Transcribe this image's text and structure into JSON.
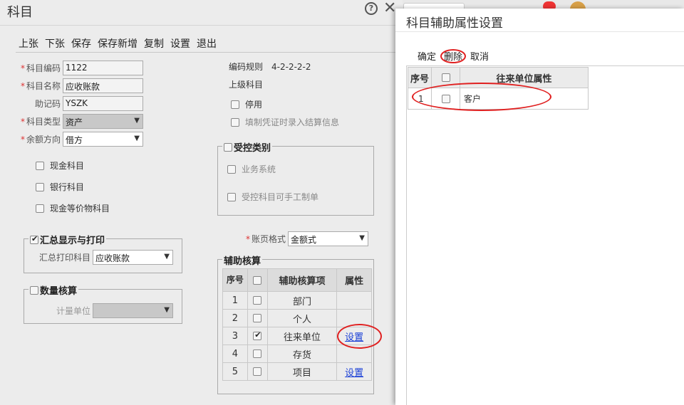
{
  "dialog": {
    "title": "科目",
    "help_glyph": "?",
    "close_glyph": "✕",
    "toolbar": [
      "上张",
      "下张",
      "保存",
      "保存新增",
      "复制",
      "设置",
      "退出"
    ]
  },
  "form": {
    "code": {
      "label": "科目编码",
      "value": "1122"
    },
    "name": {
      "label": "科目名称",
      "value": "应收账款"
    },
    "mnemonic": {
      "label": "助记码",
      "value": "YSZK"
    },
    "type": {
      "label": "科目类型",
      "value": "资产"
    },
    "balance": {
      "label": "余额方向",
      "value": "借方"
    },
    "code_rule_label": "编码规则",
    "code_rule_value": "4-2-2-2-2",
    "parent_label": "上级科目",
    "disabled_label": "停用",
    "settlement_label": "填制凭证时录入结算信息",
    "cash_label": "现金科目",
    "bank_label": "银行科目",
    "cash_equiv_label": "现金等价物科目",
    "ledger_format_label": "账页格式",
    "ledger_format_value": "金额式"
  },
  "controlled": {
    "legend": "受控类别",
    "business_system": "业务系统",
    "manual_voucher": "受控科目可手工制单"
  },
  "summary": {
    "legend": "汇总显示与打印",
    "print_label": "汇总打印科目",
    "print_value": "应收账款"
  },
  "quantity": {
    "legend": "数量核算",
    "unit_label": "计量单位"
  },
  "aux": {
    "legend": "辅助核算",
    "headers": {
      "seq": "序号",
      "item": "辅助核算项",
      "attr": "属性"
    },
    "rows": [
      {
        "seq": "1",
        "item": "部门",
        "checked": false,
        "attr": ""
      },
      {
        "seq": "2",
        "item": "个人",
        "checked": false,
        "attr": ""
      },
      {
        "seq": "3",
        "item": "往来单位",
        "checked": true,
        "attr": "设置"
      },
      {
        "seq": "4",
        "item": "存货",
        "checked": false,
        "attr": ""
      },
      {
        "seq": "5",
        "item": "项目",
        "checked": false,
        "attr": "设置"
      }
    ]
  },
  "panel": {
    "title": "科目辅助属性设置",
    "tools": [
      "确定",
      "删除",
      "取消"
    ],
    "headers": {
      "seq": "序号",
      "attr": "往来单位属性"
    },
    "rows": [
      {
        "seq": "1",
        "value": "客户"
      }
    ]
  },
  "colors": {
    "annotation": "#e02020",
    "link": "#1a3fd6"
  }
}
